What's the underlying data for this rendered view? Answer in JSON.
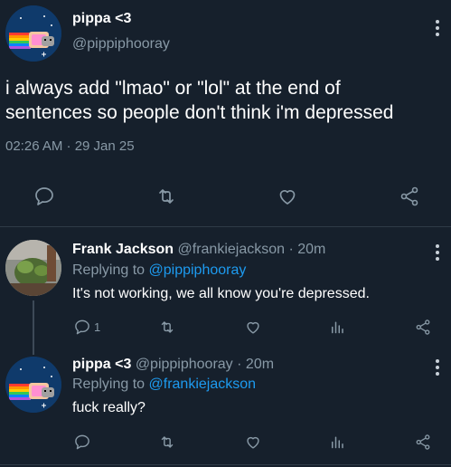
{
  "main_tweet": {
    "name": "pippa <3",
    "handle": "@pippiphooray",
    "text_line1": "i always add \"lmao\" or \"lol\" at the end of",
    "text_line2": "sentences so people don't think i'm depressed",
    "timestamp": "02:26 AM · 29 Jan 25",
    "actions": [
      "reply-icon",
      "retweet-icon",
      "like-icon",
      "share-icon"
    ]
  },
  "reply1": {
    "name": "Frank Jackson",
    "handle": "@frankiejackson",
    "time": "· 20m",
    "replying_prefix": "Replying to",
    "replying_handle": "@pippiphooray",
    "text": "It's not working, we all know you're depressed.",
    "reply_count": "1"
  },
  "reply2": {
    "name": "pippa <3",
    "handle": "@pippiphooray",
    "time": "· 20m",
    "replying_prefix": "Replying to",
    "replying_handle": "@frankiejackson",
    "text": "fuck really?"
  },
  "colors": {
    "background": "#16202c",
    "muted": "#8899a6",
    "link": "#1d9bf0",
    "divider": "#2f3b47"
  }
}
